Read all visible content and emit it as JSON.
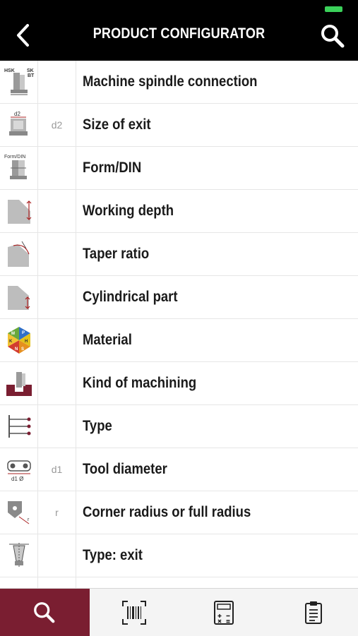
{
  "header": {
    "title": "PRODUCT CONFIGURATOR",
    "back_icon": "chevron-left-icon",
    "search_icon": "search-icon"
  },
  "rows": [
    {
      "label": "Machine spindle connection",
      "abbr": "",
      "icon": "spindle-connection-icon",
      "icon_text": [
        "HSK",
        "SK",
        "BT"
      ]
    },
    {
      "label": "Size of exit",
      "abbr": "d2",
      "icon": "exit-size-icon",
      "icon_text": [
        "d2"
      ]
    },
    {
      "label": "Form/DIN",
      "abbr": "",
      "icon": "form-din-icon",
      "icon_text": [
        "Form/DIN"
      ]
    },
    {
      "label": "Working depth",
      "abbr": "",
      "icon": "working-depth-icon"
    },
    {
      "label": "Taper ratio",
      "abbr": "",
      "icon": "taper-ratio-icon"
    },
    {
      "label": "Cylindrical part",
      "abbr": "",
      "icon": "cylindrical-part-icon"
    },
    {
      "label": "Material",
      "abbr": "",
      "icon": "material-hexagon-icon",
      "icon_text": [
        "P",
        "M",
        "H",
        "K",
        "N",
        "S"
      ]
    },
    {
      "label": "Kind of machining",
      "abbr": "",
      "icon": "machining-kind-icon"
    },
    {
      "label": "Type",
      "abbr": "",
      "icon": "type-icon"
    },
    {
      "label": "Tool diameter",
      "abbr": "d1",
      "icon": "tool-diameter-icon",
      "icon_text": [
        "d1 Ø"
      ]
    },
    {
      "label": "Corner radius or full radius",
      "abbr": "r",
      "icon": "corner-radius-icon",
      "icon_text": [
        "r"
      ]
    },
    {
      "label": "Type: exit",
      "abbr": "",
      "icon": "type-exit-icon"
    }
  ],
  "tabbar": [
    {
      "name": "search",
      "icon": "search-icon",
      "active": true
    },
    {
      "name": "barcode",
      "icon": "barcode-scan-icon",
      "active": false
    },
    {
      "name": "calculator",
      "icon": "calculator-icon",
      "active": false
    },
    {
      "name": "clipboard",
      "icon": "clipboard-icon",
      "active": false
    }
  ],
  "colors": {
    "header_bg": "#000000",
    "accent": "#7a1e31",
    "battery": "#3bd15a",
    "text": "#1a1a1a",
    "muted": "#9a9a9a"
  }
}
